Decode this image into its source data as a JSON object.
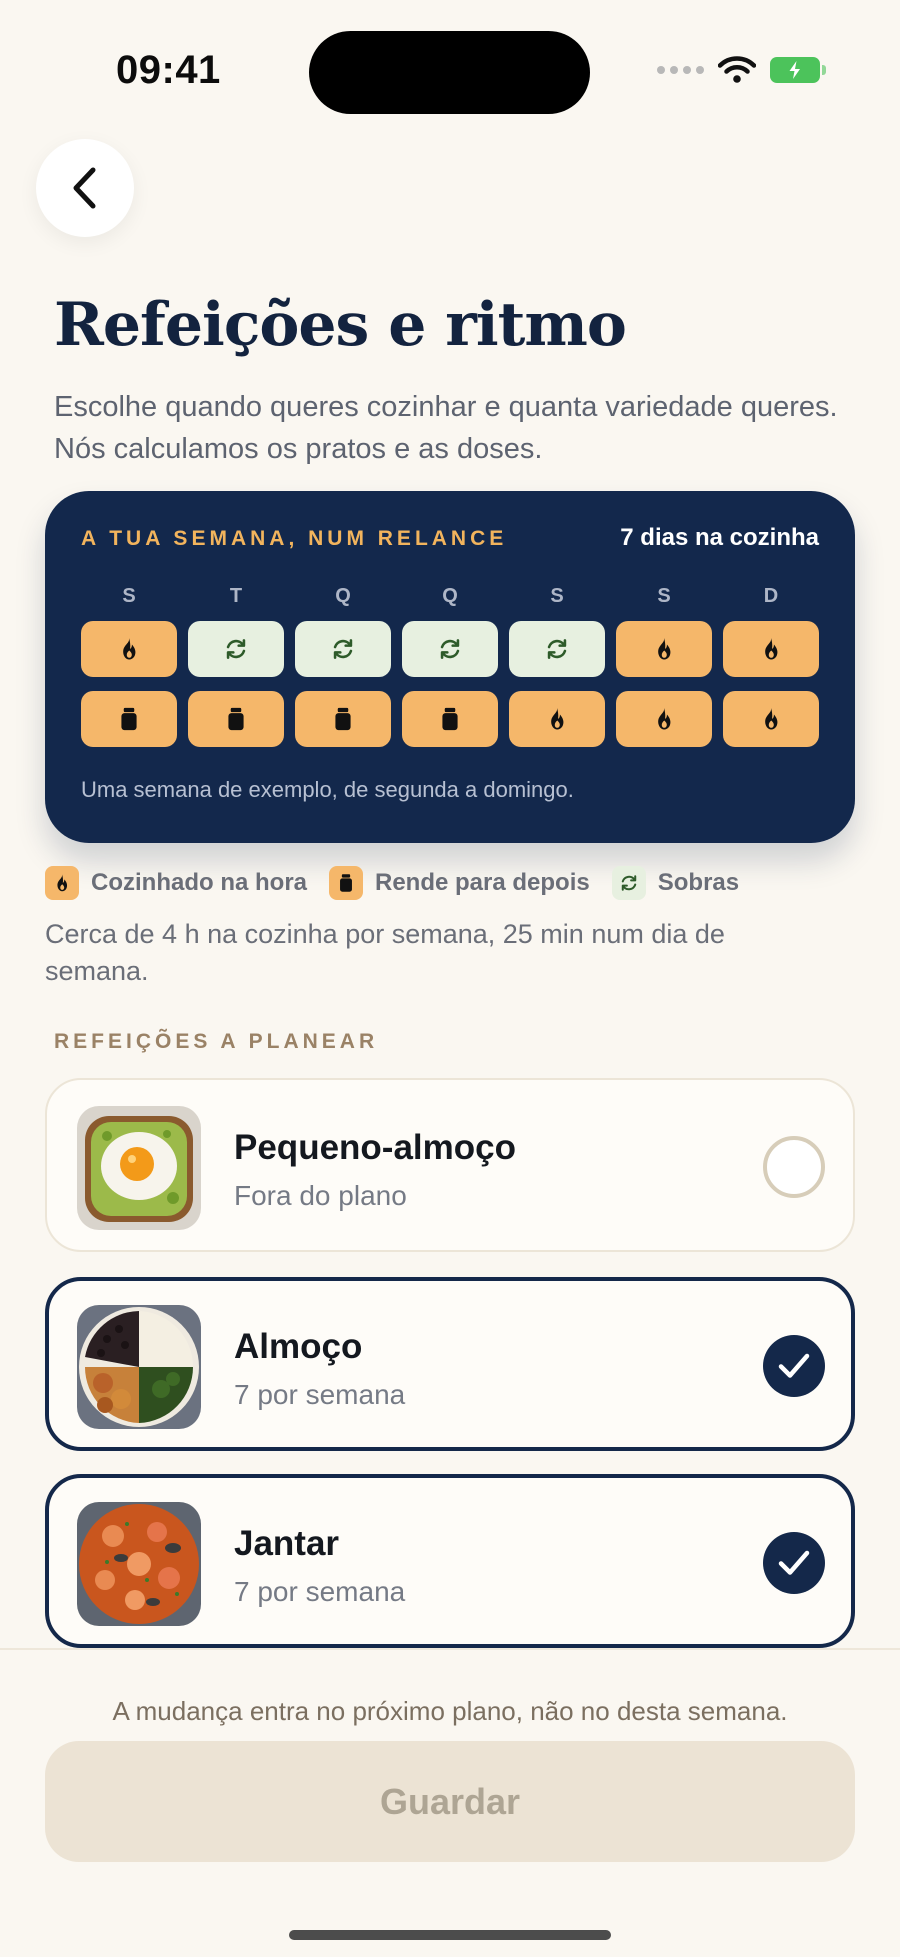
{
  "status_bar": {
    "time": "09:41"
  },
  "header": {
    "title": "Refeições e ritmo",
    "subtitle": "Escolhe quando queres cozinhar e quanta variedade queres. Nós calculamos os pratos e as doses."
  },
  "week_card": {
    "heading": "A TUA SEMANA, NUM RELANCE",
    "days_count": "7 dias na cozinha",
    "day_letters": [
      "S",
      "T",
      "Q",
      "Q",
      "S",
      "S",
      "D"
    ],
    "row1": [
      "fire",
      "sobras",
      "sobras",
      "sobras",
      "sobras",
      "fire",
      "fire"
    ],
    "row2": [
      "jar",
      "jar",
      "jar",
      "jar",
      "fire",
      "fire",
      "fire"
    ],
    "footnote": "Uma semana de exemplo, de segunda a domingo."
  },
  "legend": {
    "cooked": "Cozinhado na hora",
    "makes_later": "Rende para depois",
    "leftovers": "Sobras"
  },
  "summary": "Cerca de 4 h na cozinha por semana, 25 min num dia de semana.",
  "meals_section": {
    "label": "REFEIÇÕES A PLANEAR",
    "items": [
      {
        "name": "Pequeno-almoço",
        "count": "Fora do plano",
        "selected": false,
        "image": "avocado-toast-egg"
      },
      {
        "name": "Almoço",
        "count": "7 por semana",
        "selected": true,
        "image": "rice-beans-plantain"
      },
      {
        "name": "Jantar",
        "count": "7 por semana",
        "selected": true,
        "image": "seafood-paella"
      }
    ]
  },
  "footer": {
    "note": "A mudança entra no próximo plano, não no desta semana.",
    "save_label": "Guardar"
  },
  "colors": {
    "navy": "#13284c",
    "accent_orange": "#f5b76a",
    "leftovers_green": "#e7f0e0",
    "background": "#faf7f1"
  }
}
